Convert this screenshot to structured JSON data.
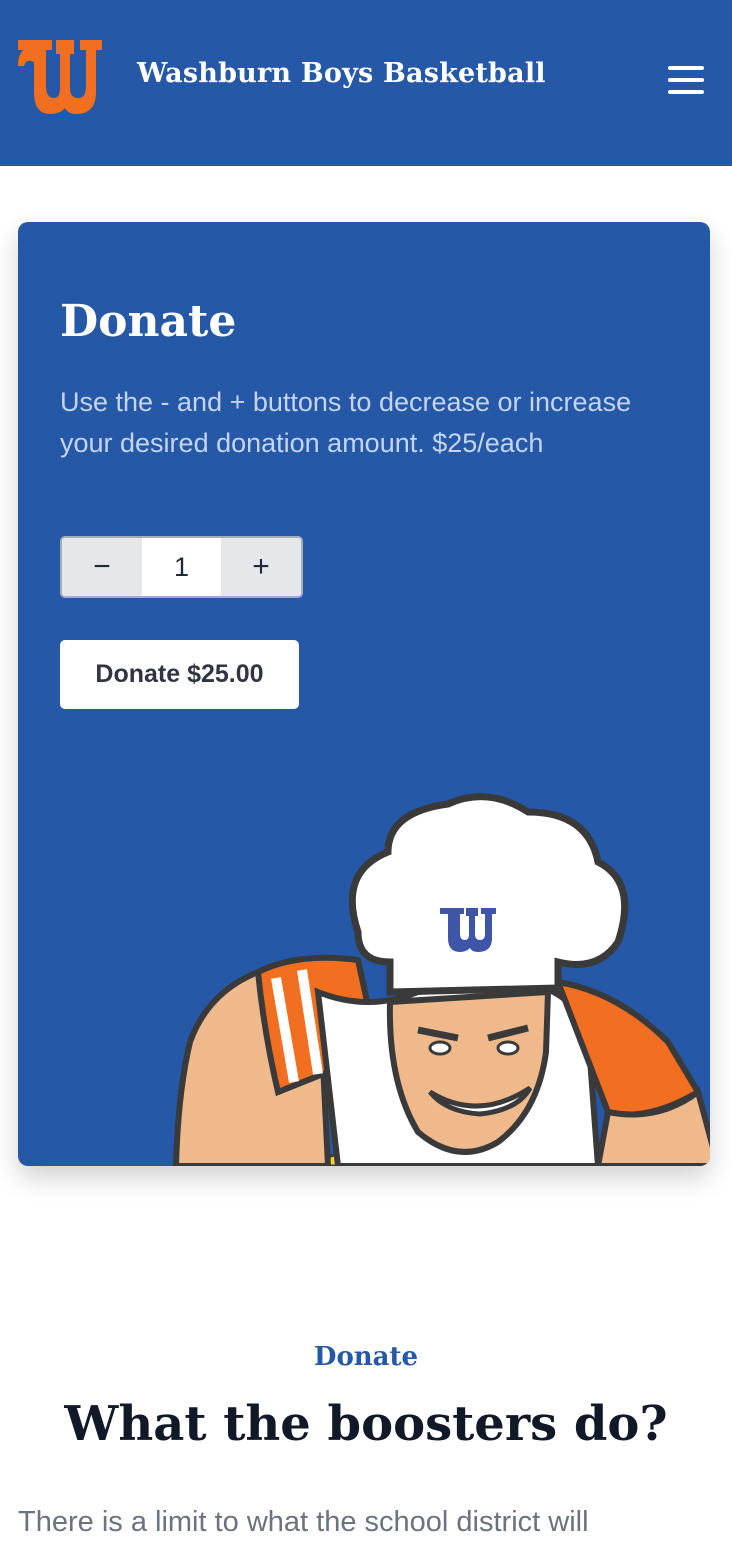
{
  "header": {
    "title": "Washburn Boys Basketball",
    "logo_icon": "washburn-w-logo-icon",
    "menu_icon": "hamburger-menu-icon",
    "bg_color": "#2558a6",
    "logo_color": "#f26f21"
  },
  "donate_card": {
    "title": "Donate",
    "description": "Use the - and + buttons to decrease or increase your desired donation amount. $25/each",
    "stepper": {
      "decrease_label": "−",
      "value": "1",
      "increase_label": "+"
    },
    "donate_button": "Donate $25.00",
    "mascot_icon": "chef-mascot-illustration"
  },
  "section": {
    "eyebrow": "Donate",
    "title": "What the boosters do?",
    "text": "There is a limit to what the school district will"
  }
}
